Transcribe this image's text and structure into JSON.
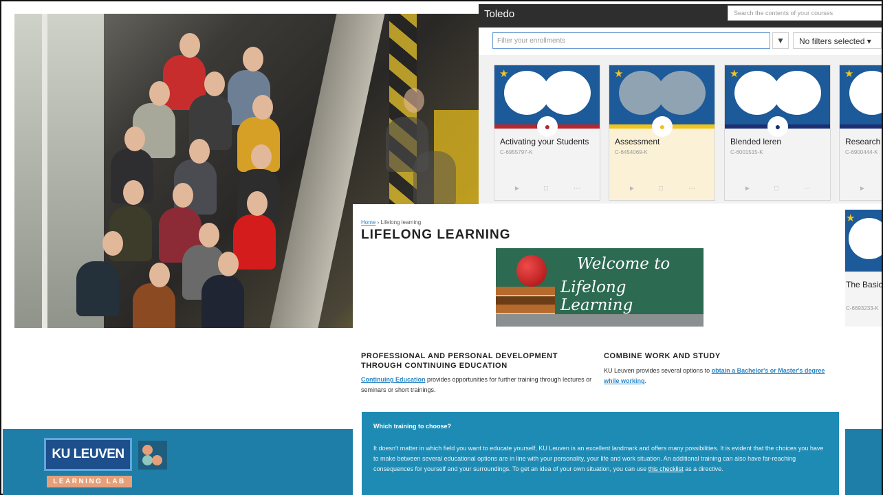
{
  "toledo": {
    "title": "Toledo",
    "search_placeholder": "Search the contents of your courses",
    "filter_placeholder": "Filter your enrollments",
    "filter_select": "No filters selected",
    "courses": [
      {
        "title": "Activating your Students",
        "code": "C-6955797-K",
        "color": "#b5262d"
      },
      {
        "title": "Assessment",
        "code": "C-6454069-K",
        "color": "#f0c419"
      },
      {
        "title": "Blended leren",
        "code": "C-6001515-K",
        "color": "#1d2f73"
      },
      {
        "title": "Research",
        "code": "C-6900444-K",
        "color": "#1d2f73"
      }
    ],
    "extra_course": {
      "title": "The Basics design",
      "code": "C-6693233-K"
    }
  },
  "lifelong": {
    "breadcrumb_home": "Home",
    "breadcrumb_current": "Lifelong learning",
    "title": "LIFELONG LEARNING",
    "banner_line1": "Welcome to",
    "banner_line2": "Lifelong Learning",
    "col1_heading": "PROFESSIONAL AND PERSONAL DEVELOPMENT THROUGH CONTINUING EDUCATION",
    "col1_link": "Continuing Education",
    "col1_text": " provides opportunities for further training through lectures or seminars or short trainings.",
    "col2_heading": "COMBINE WORK AND STUDY",
    "col2_text": "KU Leuven provides several options to ",
    "col2_link": "obtain a Bachelor's or Master's degree while working",
    "col2_end": ".",
    "box_heading": "Which training to choose?",
    "box_text": "It doesn't matter in which field you want to educate yourself, KU Leuven is an excellent landmark and offers many possibilities. It is evident that the choices you have to make between several educational options are in line with your personality, your life and work situation. An additional training can also have far-reaching consequences for yourself and your surroundings. To get an idea of your own situation, you can use ",
    "box_link": "this checklist",
    "box_end": " as a directive."
  },
  "brand": {
    "logo_text": "KU LEUVEN",
    "lab_text": "LEARNING LAB",
    "band_color": "#1e7ea7"
  }
}
